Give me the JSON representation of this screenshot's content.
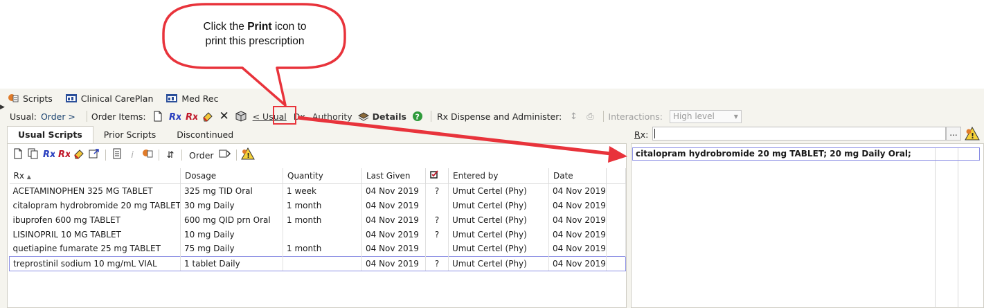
{
  "callout": {
    "text_before": "Click the ",
    "text_bold": "Print",
    "text_after": " icon to",
    "line2": "print this prescription"
  },
  "top_tabs": [
    {
      "label": "Scripts",
      "icon": "scripts-icon"
    },
    {
      "label": "Clinical CarePlan",
      "icon": "careplan-icon"
    },
    {
      "label": "Med Rec",
      "icon": "medrec-icon"
    }
  ],
  "toolbar": {
    "usual_label": "Usual:",
    "usual_value": "Order >",
    "order_items_label": "Order Items:",
    "usual_btn": "< Usual",
    "dx_btn": "Dx",
    "authority_btn": "Authority",
    "details_btn": "Details",
    "dispense_label": "Rx Dispense and Administer:",
    "interactions_label": "Interactions:",
    "interactions_value": "High level"
  },
  "sub_tabs": [
    "Usual Scripts",
    "Prior Scripts",
    "Discontinued"
  ],
  "list_toolbar": {
    "order_label": "Order"
  },
  "grid": {
    "headers": [
      "Rx",
      "Dosage",
      "Quantity",
      "Last Given",
      "",
      "Entered by",
      "Date"
    ],
    "rows": [
      [
        "ACETAMINOPHEN 325 MG TABLET",
        "325 mg TID Oral",
        "1 week",
        "04 Nov 2019",
        "?",
        "Umut Certel (Phy)",
        "04 Nov 2019"
      ],
      [
        "citalopram hydrobromide 20 mg TABLET",
        "30 mg Daily",
        "1 month",
        "04 Nov 2019",
        "",
        "Umut Certel (Phy)",
        "04 Nov 2019"
      ],
      [
        "ibuprofen 600 mg TABLET",
        "600 mg QID prn Oral",
        "1 month",
        "04 Nov 2019",
        "?",
        "Umut Certel (Phy)",
        "04 Nov 2019"
      ],
      [
        "LISINOPRIL 10 MG TABLET",
        "10 mg Daily",
        "",
        "04 Nov 2019",
        "?",
        "Umut Certel (Phy)",
        "04 Nov 2019"
      ],
      [
        "quetiapine fumarate 25 mg TABLET",
        "75 mg Daily",
        "1 month",
        "04 Nov 2019",
        "",
        "Umut Certel (Phy)",
        "04 Nov 2019"
      ],
      [
        "treprostinil sodium 10 mg/mL VIAL",
        "1 tablet Daily",
        "",
        "04 Nov 2019",
        "?",
        "Umut Certel (Phy)",
        "04 Nov 2019"
      ]
    ],
    "selected_row": 5
  },
  "rx_panel": {
    "label_underlined": "R",
    "label_rest": "x:",
    "ellipsis": "...",
    "selected_item": "citalopram hydrobromide 20 mg TABLET; 20 mg Daily Oral;"
  },
  "colors": {
    "callout_border": "#e8333b",
    "selection_border": "#8a8ee4",
    "panel_bg": "#f5f4ee"
  }
}
